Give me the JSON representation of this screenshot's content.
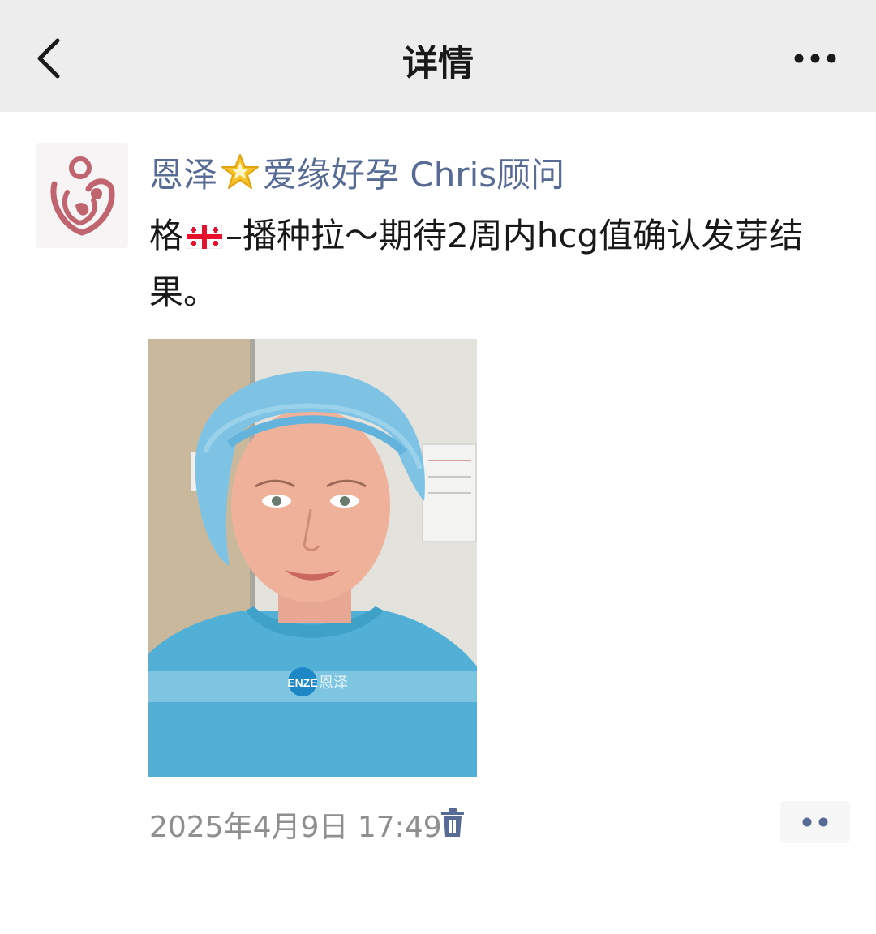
{
  "header": {
    "title": "详情",
    "back_icon": "chevron-left-icon",
    "more_icon": "more-dots-icon"
  },
  "post": {
    "author_prefix": "恩泽",
    "author_emoji": "star-icon",
    "author_suffix": "爱缘好孕 Chris顾问",
    "text_before_flag": "格",
    "flag_icon": "georgia-flag-icon",
    "text_after_flag": "–播种拉～期待2周内hcg值确认发芽结果。",
    "photo_watermark": "ENZE",
    "photo_watermark_cn": "恩泽",
    "timestamp": "2025年4月9日 17:49",
    "delete_icon": "trash-icon",
    "action_icon": "two-dots-icon"
  },
  "colors": {
    "header_bg": "#ededed",
    "author_link": "#576b95",
    "text": "#191919",
    "meta": "#8f8f8f",
    "brand": "#c0646f"
  }
}
